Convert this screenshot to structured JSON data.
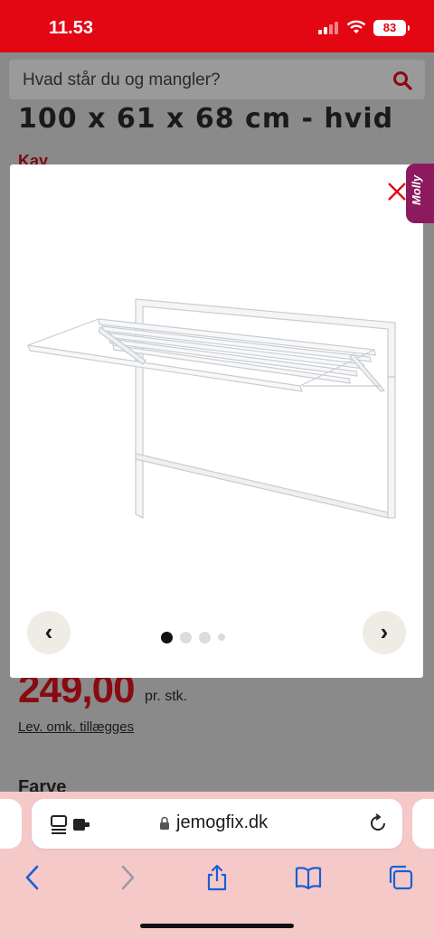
{
  "status": {
    "time": "11.53",
    "battery": "83"
  },
  "search": {
    "placeholder": "Hvad står du og mangler?"
  },
  "product": {
    "title": "100 x 61 x 68 cm - hvid",
    "brand": "Kay",
    "price": "249,00",
    "unit": "pr. stk.",
    "delivery": "Lev. omk. tillægges",
    "color_label": "Farve"
  },
  "gallery": {
    "prev": "‹",
    "next": "›",
    "dot_count": 4,
    "active_index": 0
  },
  "chat": {
    "label": "Molly"
  },
  "browser": {
    "url": "jemogfix.dk"
  },
  "colors": {
    "brand_red": "#e30613",
    "safari_blue": "#1a5fd6",
    "chat_purple": "#8c1a5e"
  }
}
